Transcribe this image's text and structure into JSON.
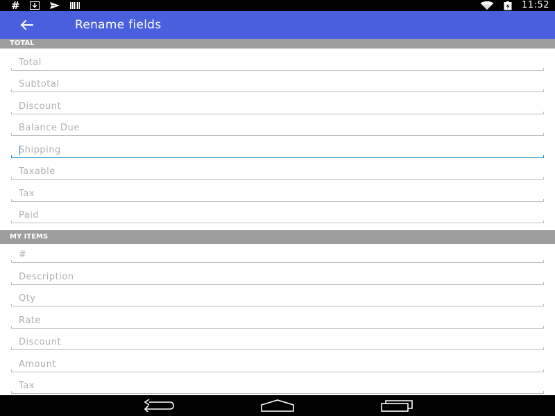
{
  "statusbar": {
    "time": "11:52",
    "hash_icon": "#"
  },
  "appbar": {
    "title": "Rename fields",
    "back_icon": "arrow-back-icon",
    "color": "#4a5fde"
  },
  "sections": {
    "total": {
      "header": "TOTAL",
      "fields": [
        "Total",
        "Subtotal",
        "Discount",
        "Balance Due",
        "Shipping",
        "Taxable",
        "Tax",
        "Paid"
      ],
      "focused": "Shipping"
    },
    "items": {
      "header": "MY ITEMS",
      "fields": [
        "#",
        "Description",
        "Qty",
        "Rate",
        "Discount",
        "Amount",
        "Tax"
      ]
    }
  },
  "navbar": {
    "back_icon": "nav-back-icon",
    "home_icon": "nav-home-icon",
    "recents_icon": "nav-recents-icon"
  },
  "colors": {
    "accent": "#1e88c8",
    "header_gray": "#9e9e9e"
  }
}
